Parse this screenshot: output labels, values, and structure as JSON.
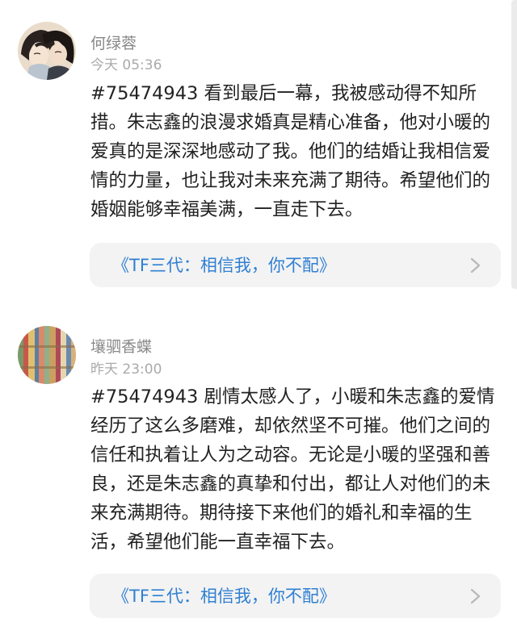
{
  "comments": [
    {
      "username": "何绿蓉",
      "timestamp": "今天 05:36",
      "text": "#75474943 看到最后一幕，我被感动得不知所措。朱志鑫的浪漫求婚真是精心准备，他对小暖的爱真的是深深地感动了我。他们的结婚让我相信爱情的力量，也让我对未来充满了期待。希望他们的婚姻能够幸福美满，一直走下去。",
      "link": "《TF三代：相信我，你不配》",
      "avatar_icon": "anime-couple-avatar"
    },
    {
      "username": "壤驷香蝶",
      "timestamp": "昨天 23:00",
      "text": "#75474943 剧情太感人了，小暖和朱志鑫的爱情经历了这么多磨难，却依然坚不可摧。他们之间的信任和执着让人为之动容。无论是小暖的坚强和善良，还是朱志鑫的真挚和付出，都让人对他们的未来充满期待。期待接下来他们的婚礼和幸福的生活，希望他们能一直幸福下去。",
      "link": "《TF三代：相信我，你不配》",
      "avatar_icon": "bookshelf-avatar"
    }
  ],
  "colors": {
    "link": "#2f7fd2",
    "card_background": "#f3f3f3",
    "meta_text": "#888888",
    "body_text": "#222222"
  }
}
